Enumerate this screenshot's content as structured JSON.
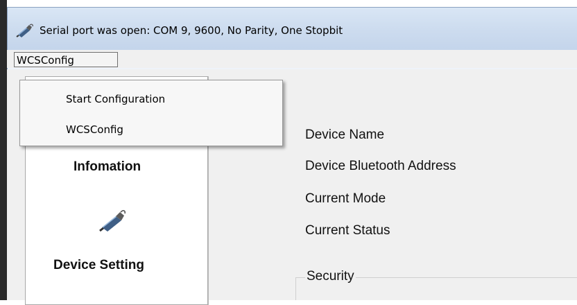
{
  "window": {
    "title": "Serial port was open: COM 9, 9600, No Parity, One Stopbit",
    "icon": "usb-adapter-icon"
  },
  "menubar": {
    "menus": [
      {
        "label": "WCSConfig"
      }
    ]
  },
  "dropdown": {
    "items": [
      {
        "label": "Start Configuration"
      },
      {
        "label": "WCSConfig"
      }
    ]
  },
  "sidebar": {
    "items": [
      {
        "label": "Infomation"
      },
      {
        "label": "Device Setting",
        "icon": "usb-adapter-icon"
      }
    ]
  },
  "main": {
    "properties": [
      {
        "label": "Device Name"
      },
      {
        "label": "Device Bluetooth Address"
      },
      {
        "label": "Current Mode"
      },
      {
        "label": "Current Status"
      }
    ],
    "security_group": {
      "title": "Security"
    }
  }
}
